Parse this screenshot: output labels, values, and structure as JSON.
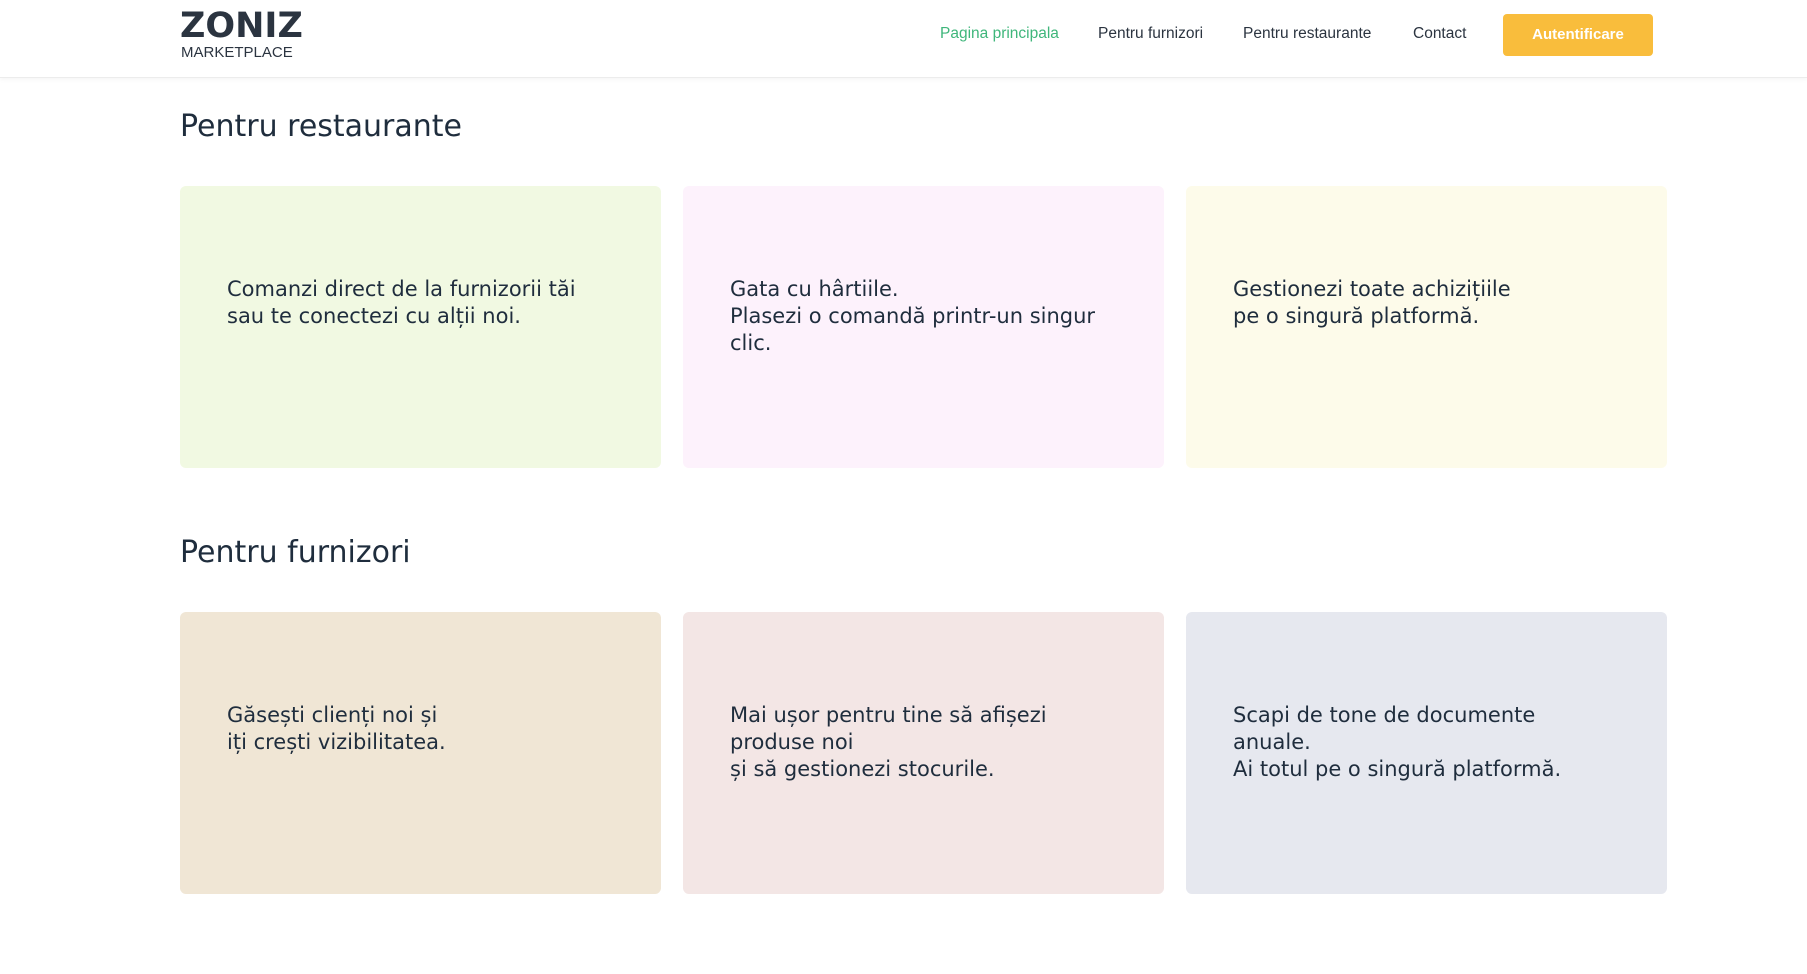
{
  "header": {
    "logo": {
      "word": "ZONIZ",
      "sub": "MARKETPLACE"
    },
    "nav": [
      {
        "label": "Pagina principala",
        "active": true
      },
      {
        "label": "Pentru furnizori",
        "active": false
      },
      {
        "label": "Pentru restaurante",
        "active": false
      },
      {
        "label": "Contact",
        "active": false
      }
    ],
    "login_label": "Autentificare"
  },
  "colors": {
    "accent_green": "#3fb67b",
    "button_yellow": "#f9bd3c",
    "text_dark": "#1f2d3d",
    "card_restaurant_1": "#f1f9e2",
    "card_restaurant_2": "#fdf2fc",
    "card_restaurant_3": "#fdfbea",
    "card_supplier_1": "#f0e6d5",
    "card_supplier_2": "#f3e6e5",
    "card_supplier_3": "#e6e8ef"
  },
  "sections": [
    {
      "title": "Pentru restaurante",
      "cards": [
        {
          "text": "Comanzi direct de la furnizorii tăi\nsau te conectezi cu alții noi."
        },
        {
          "text": "Gata cu hârtiile.\nPlasezi o comandă printr-un singur\nclic."
        },
        {
          "text": "Gestionezi toate achizițiile\npe o singură platformă."
        }
      ]
    },
    {
      "title": "Pentru furnizori",
      "cards": [
        {
          "text": "Găsești clienți noi și\niți crești vizibilitatea."
        },
        {
          "text": "Mai ușor pentru tine să afișezi\nproduse noi\nși să gestionezi stocurile."
        },
        {
          "text": "Scapi de tone de documente\nanuale.\nAi totul pe o singură platformă."
        }
      ]
    }
  ]
}
